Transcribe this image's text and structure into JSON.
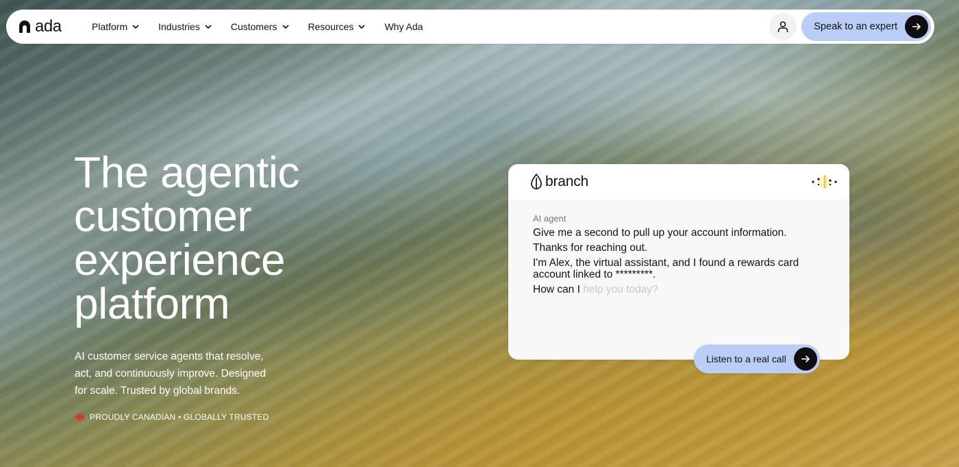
{
  "nav": {
    "logo_text": "ada",
    "items": [
      {
        "label": "Platform",
        "has_dropdown": true
      },
      {
        "label": "Industries",
        "has_dropdown": true
      },
      {
        "label": "Customers",
        "has_dropdown": true
      },
      {
        "label": "Resources",
        "has_dropdown": true
      },
      {
        "label": "Why Ada",
        "has_dropdown": false
      }
    ],
    "account_icon": "user-icon",
    "cta_label": "Speak to an expert",
    "cta_icon": "arrow-right-icon"
  },
  "hero": {
    "title_lines": [
      "The agentic",
      "customer",
      "experience",
      "platform"
    ],
    "subtitle_lines": [
      "AI customer service agents that resolve,",
      "act, and continuously improve. Designed",
      "for scale. Trusted by global brands."
    ],
    "badge_icon": "maple-leaf-icon",
    "badge_text": "PROUDLY CANADIAN • GLOBALLY TRUSTED"
  },
  "chat_card": {
    "brand_name": "branch",
    "brand_icon": "leaf-logo-icon",
    "voice_icon": "voice-dots-icon",
    "agent_label": "AI agent",
    "messages": [
      "Give me a second to pull up your account information.",
      "Thanks for reaching out.",
      "I'm Alex, the virtual assistant, and I found a rewards card account linked to *********."
    ],
    "typing_visible": "How can I",
    "typing_pending": " help you today?",
    "listen_label": "Listen to a real call",
    "listen_icon": "arrow-right-icon"
  },
  "colors": {
    "cta_bg": "#b9cdf6",
    "arrow_bg": "#0f0f0f",
    "maple_red": "#d8342a"
  }
}
